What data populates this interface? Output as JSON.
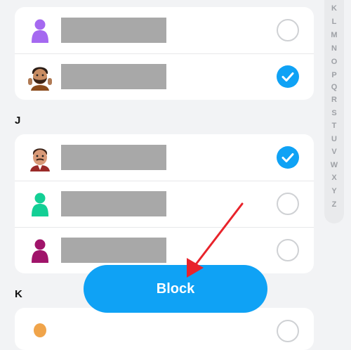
{
  "sections": [
    {
      "letter": "",
      "contacts": [
        {
          "avatar": "purple-silhouette-icon",
          "selected": false
        },
        {
          "avatar": "bitmoji-bearded-man-icon",
          "selected": true
        }
      ]
    },
    {
      "letter": "J",
      "contacts": [
        {
          "avatar": "bitmoji-mustache-man-icon",
          "selected": true
        },
        {
          "avatar": "green-silhouette-icon",
          "selected": false
        },
        {
          "avatar": "magenta-silhouette-icon",
          "selected": false
        }
      ]
    },
    {
      "letter": "K",
      "contacts": [
        {
          "avatar": "orange-avatar-icon",
          "selected": false
        }
      ]
    }
  ],
  "index_letters": [
    "K",
    "L",
    "M",
    "N",
    "O",
    "P",
    "Q",
    "R",
    "S",
    "T",
    "U",
    "V",
    "W",
    "X",
    "Y",
    "Z"
  ],
  "block_button": {
    "label": "Block"
  },
  "colors": {
    "accent": "#0fa2f5",
    "annotation_arrow": "#e8232b",
    "redacted_name": "#a8a8a8",
    "purple_avatar": "#a569f0",
    "green_avatar": "#13cf95",
    "magenta_avatar": "#a0146a"
  }
}
